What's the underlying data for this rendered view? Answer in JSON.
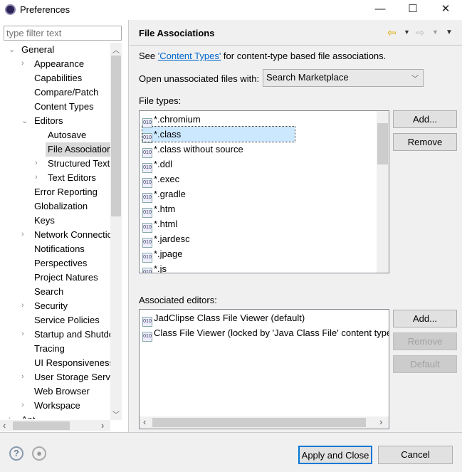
{
  "window": {
    "title": "Preferences",
    "minimize": "—",
    "maximize": "☐",
    "close": "✕"
  },
  "sidebar": {
    "filter_placeholder": "type filter text",
    "items": [
      {
        "label": "General",
        "depth": 0,
        "exp": "open"
      },
      {
        "label": "Appearance",
        "depth": 1,
        "exp": "closed"
      },
      {
        "label": "Capabilities",
        "depth": 1
      },
      {
        "label": "Compare/Patch",
        "depth": 1
      },
      {
        "label": "Content Types",
        "depth": 1
      },
      {
        "label": "Editors",
        "depth": 1,
        "exp": "open"
      },
      {
        "label": "Autosave",
        "depth": 2
      },
      {
        "label": "File Associations",
        "depth": 2,
        "selected": true
      },
      {
        "label": "Structured Text",
        "depth": 2,
        "exp": "closed"
      },
      {
        "label": "Text Editors",
        "depth": 2,
        "exp": "closed"
      },
      {
        "label": "Error Reporting",
        "depth": 1
      },
      {
        "label": "Globalization",
        "depth": 1
      },
      {
        "label": "Keys",
        "depth": 1
      },
      {
        "label": "Network Connections",
        "depth": 1,
        "exp": "closed"
      },
      {
        "label": "Notifications",
        "depth": 1
      },
      {
        "label": "Perspectives",
        "depth": 1
      },
      {
        "label": "Project Natures",
        "depth": 1
      },
      {
        "label": "Search",
        "depth": 1
      },
      {
        "label": "Security",
        "depth": 1,
        "exp": "closed"
      },
      {
        "label": "Service Policies",
        "depth": 1
      },
      {
        "label": "Startup and Shutdown",
        "depth": 1,
        "exp": "closed"
      },
      {
        "label": "Tracing",
        "depth": 1
      },
      {
        "label": "UI Responsiveness",
        "depth": 1
      },
      {
        "label": "User Storage Service",
        "depth": 1,
        "exp": "closed"
      },
      {
        "label": "Web Browser",
        "depth": 1
      },
      {
        "label": "Workspace",
        "depth": 1,
        "exp": "closed"
      },
      {
        "label": "Ant",
        "depth": 0,
        "exp": "closed"
      }
    ]
  },
  "page": {
    "title": "File Associations",
    "see_prefix": "See ",
    "see_link": "'Content Types'",
    "see_suffix": " for content-type based file associations.",
    "open_label": "Open unassociated files with:",
    "open_value": "Search Marketplace",
    "file_types_label": "File types:",
    "file_types": [
      {
        "label": "*.chromium",
        "icon": "chromium-icon"
      },
      {
        "label": "*.class",
        "icon": "class-file-icon",
        "selected": true
      },
      {
        "label": "*.class without source",
        "icon": "class-file-icon"
      },
      {
        "label": "*.ddl",
        "icon": "ddl-icon"
      },
      {
        "label": "*.exec",
        "icon": "exec-icon"
      },
      {
        "label": "*.gradle",
        "icon": "gradle-icon"
      },
      {
        "label": "*.htm",
        "icon": "html-file-icon"
      },
      {
        "label": "*.html",
        "icon": "html-file-icon"
      },
      {
        "label": "*.jardesc",
        "icon": "jardesc-icon"
      },
      {
        "label": "*.jpage",
        "icon": "jpage-icon"
      },
      {
        "label": "*.js",
        "icon": "js-file-icon"
      }
    ],
    "ft_add": "Add...",
    "ft_remove": "Remove",
    "editors_label": "Associated editors:",
    "editors": [
      {
        "label": "JadClipse Class File Viewer (default)",
        "icon": "class-file-icon"
      },
      {
        "label": "Class File Viewer (locked by 'Java Class File' content type)",
        "icon": "class-file-icon"
      }
    ],
    "ed_add": "Add...",
    "ed_remove": "Remove",
    "ed_default": "Default"
  },
  "footer": {
    "apply_close": "Apply and Close",
    "cancel": "Cancel"
  },
  "colors": {
    "selection": "#cce8ff",
    "link": "#0066cc",
    "accent": "#0078d7"
  }
}
